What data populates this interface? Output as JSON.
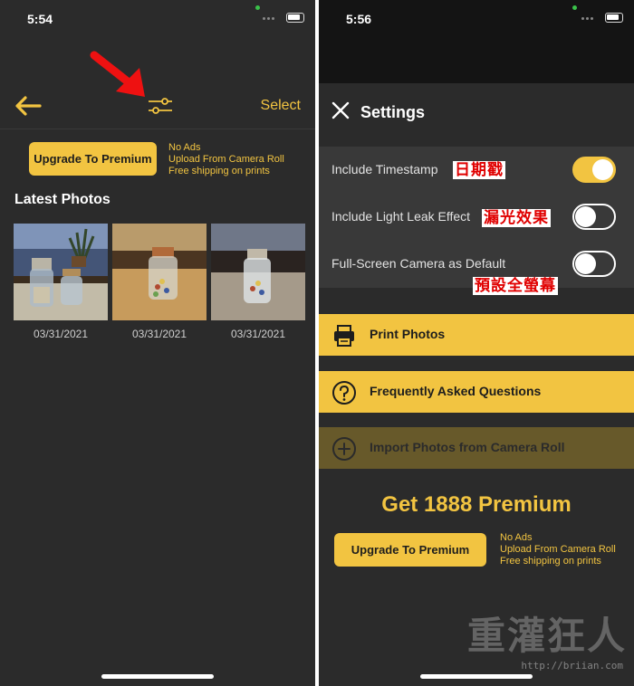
{
  "left": {
    "time": "5:54",
    "select_label": "Select",
    "upgrade_label": "Upgrade To Premium",
    "benefits": [
      "No Ads",
      "Upload From Camera Roll",
      "Free shipping on prints"
    ],
    "section_title": "Latest Photos",
    "photos": [
      {
        "date": "03/31/2021"
      },
      {
        "date": "03/31/2021"
      },
      {
        "date": "03/31/2021"
      }
    ]
  },
  "right": {
    "time": "5:56",
    "title": "Settings",
    "toggles": [
      {
        "label": "Include Timestamp",
        "on": true,
        "annotation": "日期戳"
      },
      {
        "label": "Include Light Leak Effect",
        "on": false,
        "annotation": "漏光效果"
      },
      {
        "label": "Full-Screen Camera as Default",
        "on": false,
        "annotation": "預設全螢幕"
      }
    ],
    "menu": [
      {
        "label": "Print Photos",
        "icon": "printer-icon"
      },
      {
        "label": "Frequently Asked Questions",
        "icon": "question-icon"
      },
      {
        "label": "Import Photos from Camera Roll",
        "icon": "plus-icon"
      }
    ],
    "promo_title": "Get 1888 Premium",
    "upgrade_label": "Upgrade To Premium",
    "benefits": [
      "No Ads",
      "Upload From Camera Roll",
      "Free shipping on prints"
    ],
    "watermark": "重灌狂人",
    "watermark_url": "http://briian.com"
  },
  "colors": {
    "accent": "#f2c441",
    "background": "#2b2b2b",
    "annotation": "#e00000"
  }
}
